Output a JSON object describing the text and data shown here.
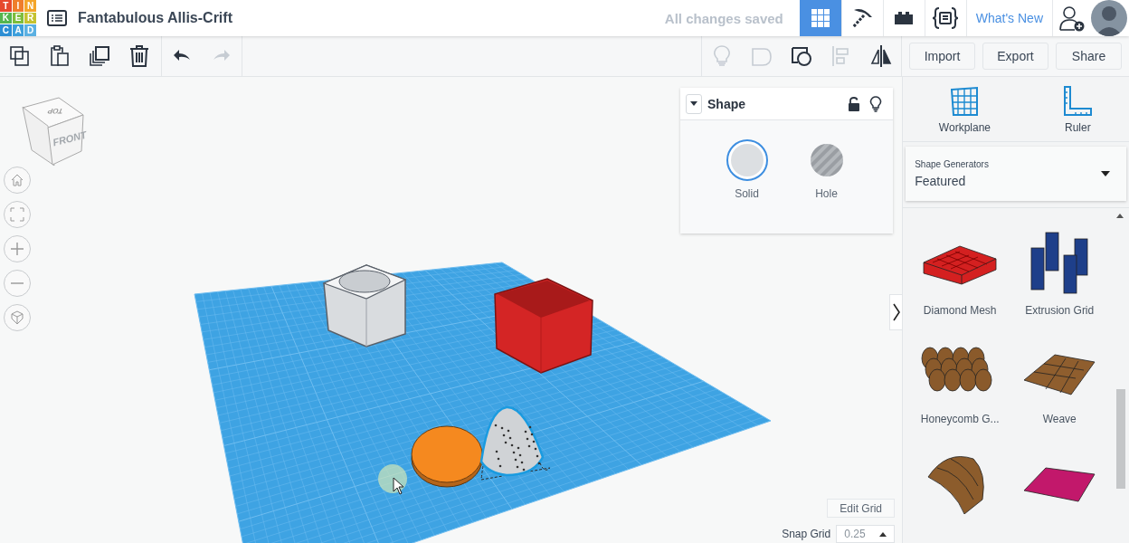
{
  "header": {
    "logo": [
      {
        "letter": "T",
        "color": "#e6492d"
      },
      {
        "letter": "I",
        "color": "#ef7d2c"
      },
      {
        "letter": "N",
        "color": "#f4a52a"
      },
      {
        "letter": "K",
        "color": "#55b54f"
      },
      {
        "letter": "E",
        "color": "#7dbd3d"
      },
      {
        "letter": "R",
        "color": "#c5c230"
      },
      {
        "letter": "C",
        "color": "#2c8ed4"
      },
      {
        "letter": "A",
        "color": "#3c9fdc"
      },
      {
        "letter": "D",
        "color": "#5bb0e2"
      }
    ],
    "title": "Fantabulous Allis-Crift",
    "save_status": "All changes saved",
    "modes": [
      {
        "kind": "grid",
        "selected": true
      },
      {
        "kind": "pickaxe",
        "selected": false
      },
      {
        "kind": "brick",
        "selected": false
      },
      {
        "kind": "code",
        "selected": false
      }
    ],
    "whats_new": "What's New"
  },
  "toolbar": {
    "edit_tools": [
      {
        "kind": "copy",
        "disabled": false
      },
      {
        "kind": "paste",
        "disabled": false
      },
      {
        "kind": "duplicate",
        "disabled": false
      },
      {
        "kind": "delete",
        "disabled": false
      },
      {
        "kind": "undo",
        "disabled": false
      },
      {
        "kind": "redo",
        "disabled": true
      }
    ],
    "shape_tools": [
      {
        "kind": "bulb",
        "disabled": true
      },
      {
        "kind": "group",
        "disabled": true
      },
      {
        "kind": "ungroup",
        "disabled": false
      },
      {
        "kind": "align",
        "disabled": true
      },
      {
        "kind": "mirror",
        "disabled": false
      }
    ],
    "actions": [
      "Import",
      "Export",
      "Share"
    ]
  },
  "view_cube": {
    "top": "TOP",
    "front": "FRONT"
  },
  "shape_panel": {
    "title": "Shape",
    "options": [
      {
        "kind": "solid",
        "label": "Solid",
        "selected": true
      },
      {
        "kind": "hole",
        "label": "Hole",
        "selected": false
      }
    ]
  },
  "grid": {
    "edit": "Edit Grid",
    "snap_label": "Snap Grid",
    "snap_value": "0.25"
  },
  "right_panel": {
    "tools": [
      {
        "kind": "workplane",
        "label": "Workplane"
      },
      {
        "kind": "ruler",
        "label": "Ruler"
      }
    ],
    "generator": {
      "label": "Shape Generators",
      "value": "Featured"
    },
    "shapes": [
      {
        "kind": "mesh",
        "name": "Diamond Mesh",
        "color": "#d42020"
      },
      {
        "kind": "columns",
        "name": "Extrusion Grid",
        "color": "#1e3f8a"
      },
      {
        "kind": "honeycomb",
        "name": "Honeycomb G...",
        "color": "#8a5a2b"
      },
      {
        "kind": "weave",
        "name": "Weave",
        "color": "#8f5e2e"
      },
      {
        "kind": "curved",
        "color": "#8c5c2c"
      },
      {
        "kind": "plate",
        "color": "#c2186b"
      }
    ]
  }
}
